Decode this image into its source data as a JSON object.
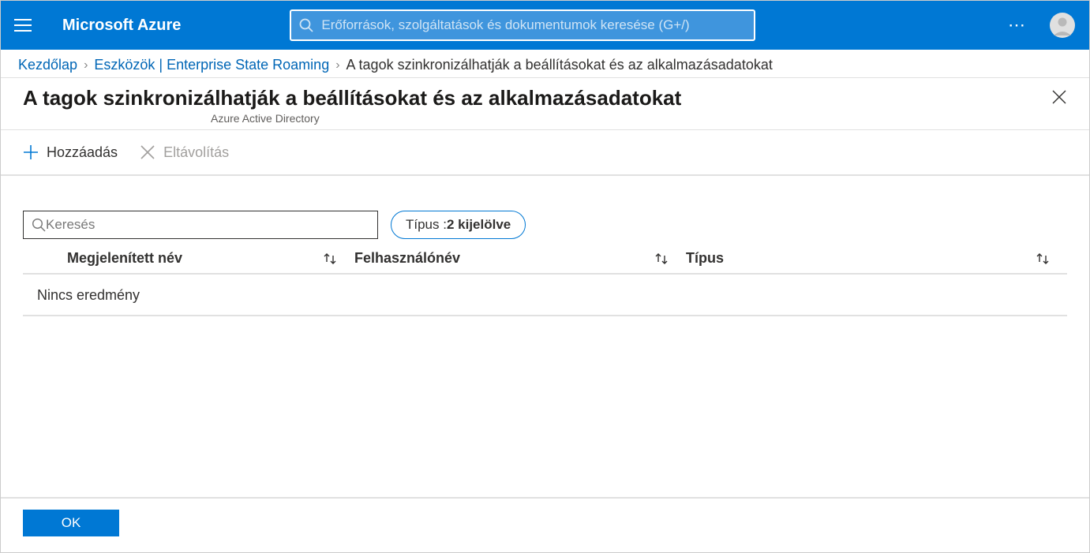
{
  "topbar": {
    "brand": "Microsoft Azure",
    "search_placeholder": "Erőforrások, szolgáltatások és dokumentumok keresése (G+/)"
  },
  "breadcrumb": {
    "home": "Kezdőlap",
    "devices": "Eszközök | Enterprise State Roaming",
    "current": "A tagok szinkronizálhatják a beállításokat és az alkalmazásadatokat"
  },
  "page": {
    "title": "A tagok szinkronizálhatják a beállításokat és az alkalmazásadatokat",
    "subtitle": "Azure Active Directory"
  },
  "commands": {
    "add": "Hozzáadás",
    "remove": "Eltávolítás"
  },
  "filters": {
    "search_placeholder": "Keresés",
    "type_label": "Típus : ",
    "type_value": "2 kijelölve"
  },
  "table": {
    "columns": {
      "display_name": "Megjelenített név",
      "username": "Felhasználónév",
      "type": "Típus"
    },
    "empty": "Nincs eredmény"
  },
  "footer": {
    "ok": "OK"
  }
}
